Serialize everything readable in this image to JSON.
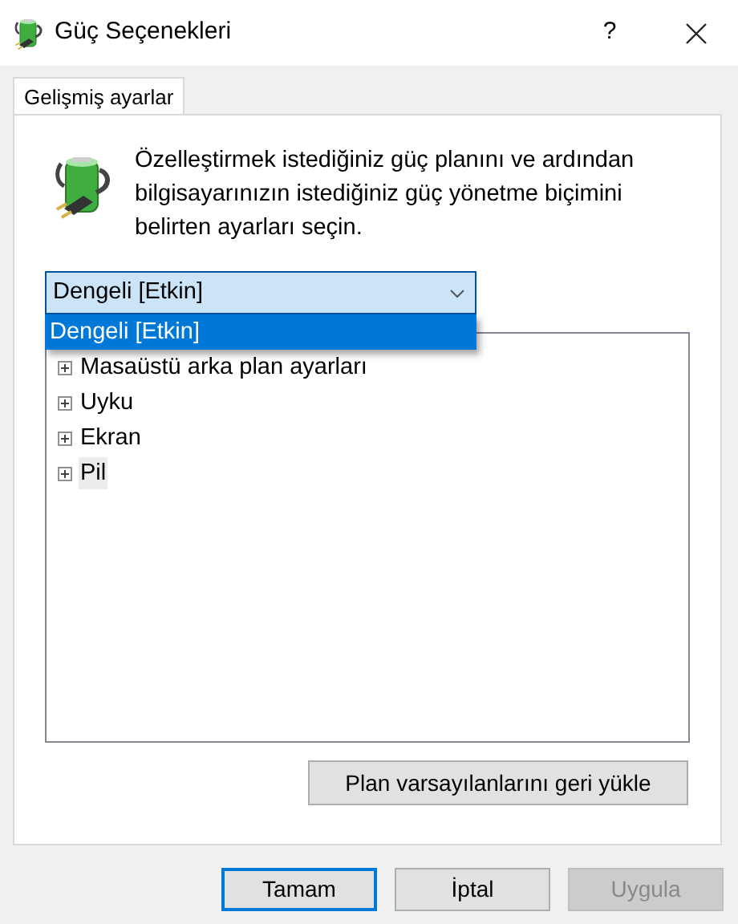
{
  "window": {
    "title": "Güç Seçenekleri",
    "help": "?"
  },
  "tabs": [
    {
      "label": "Gelişmiş ayarlar",
      "selected": true
    }
  ],
  "description": "Özelleştirmek istediğiniz güç planını ve ardından bilgisayarınızın istediğiniz güç yönetme biçimini belirten ayarları seçin.",
  "plan_select": {
    "value": "Dengeli [Etkin]",
    "expanded": true,
    "options": [
      {
        "label": "Dengeli [Etkin]",
        "selected": true
      }
    ]
  },
  "tree": [
    {
      "label": "Masaüstü arka plan ayarları",
      "expanded": false,
      "selected": false
    },
    {
      "label": "Uyku",
      "expanded": false,
      "selected": false
    },
    {
      "label": "Ekran",
      "expanded": false,
      "selected": false
    },
    {
      "label": "Pil",
      "expanded": false,
      "selected": true
    }
  ],
  "restore_button": "Plan varsayılanlarını geri yükle",
  "buttons": [
    {
      "label": "Tamam",
      "default": true,
      "disabled": false
    },
    {
      "label": "İptal",
      "default": false,
      "disabled": false
    },
    {
      "label": "Uygula",
      "default": false,
      "disabled": true
    }
  ]
}
